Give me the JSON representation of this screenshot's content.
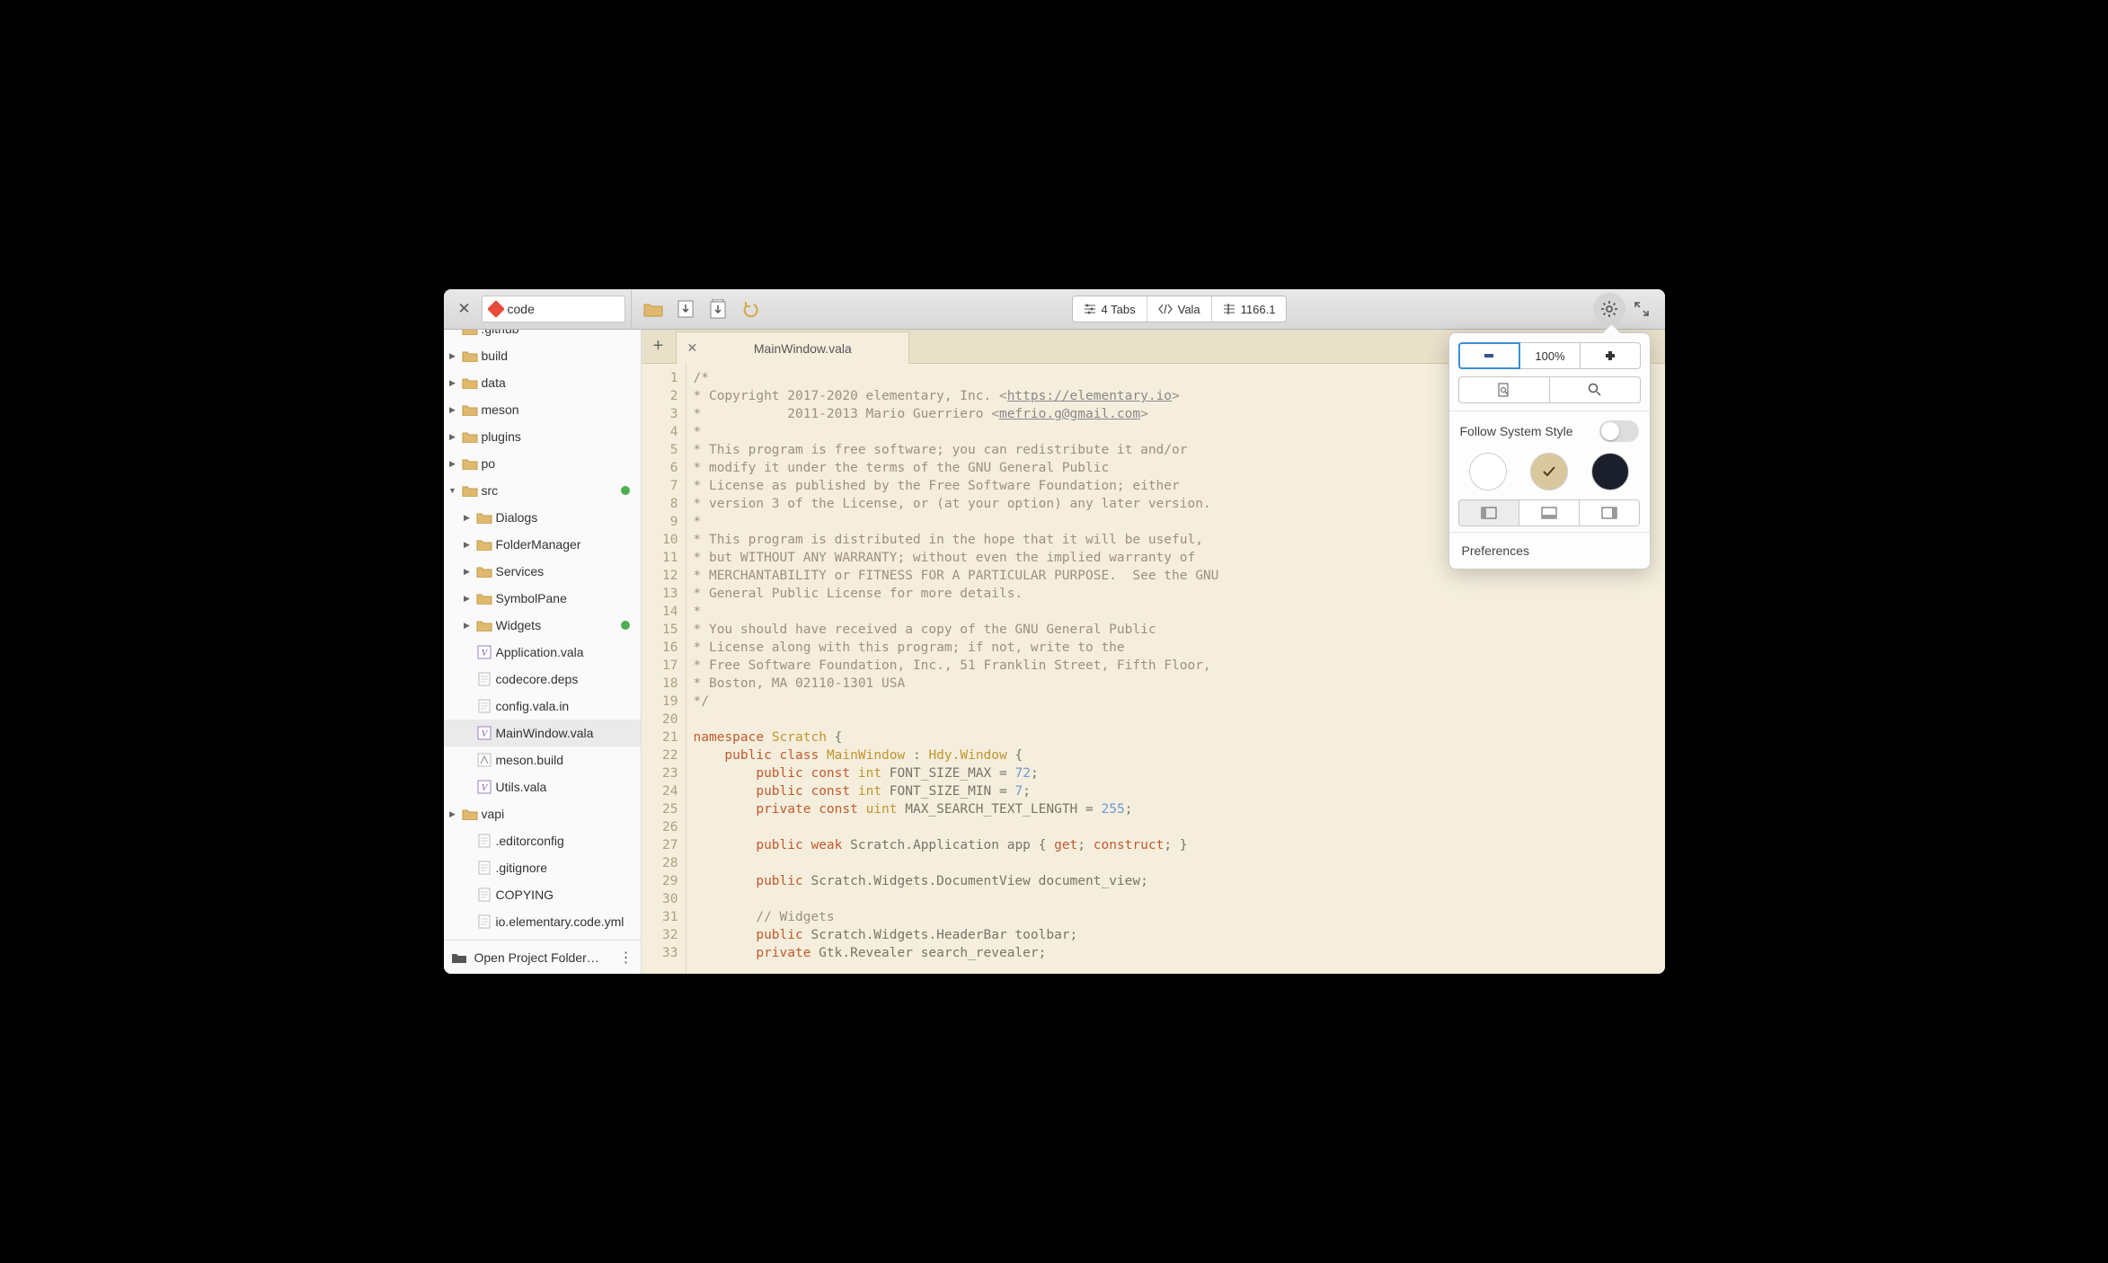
{
  "title_chip": "code",
  "toolbar": {
    "tabs_label": "4 Tabs",
    "lang_label": "Vala",
    "cursor_label": "1166.1"
  },
  "sidebar": {
    "items": [
      {
        "depth": 0,
        "icon": "folder",
        "label": ".github",
        "tri": "none",
        "partial": true
      },
      {
        "depth": 0,
        "icon": "folder",
        "label": "build",
        "tri": "right"
      },
      {
        "depth": 0,
        "icon": "folder",
        "label": "data",
        "tri": "right"
      },
      {
        "depth": 0,
        "icon": "folder",
        "label": "meson",
        "tri": "right"
      },
      {
        "depth": 0,
        "icon": "folder",
        "label": "plugins",
        "tri": "right"
      },
      {
        "depth": 0,
        "icon": "folder",
        "label": "po",
        "tri": "right"
      },
      {
        "depth": 0,
        "icon": "folder",
        "label": "src",
        "tri": "down",
        "dot": true
      },
      {
        "depth": 1,
        "icon": "folder",
        "label": "Dialogs",
        "tri": "right"
      },
      {
        "depth": 1,
        "icon": "folder",
        "label": "FolderManager",
        "tri": "right"
      },
      {
        "depth": 1,
        "icon": "folder",
        "label": "Services",
        "tri": "right"
      },
      {
        "depth": 1,
        "icon": "folder",
        "label": "SymbolPane",
        "tri": "right"
      },
      {
        "depth": 1,
        "icon": "folder",
        "label": "Widgets",
        "tri": "right",
        "dot": true
      },
      {
        "depth": 1,
        "icon": "vala",
        "label": "Application.vala",
        "tri": "none"
      },
      {
        "depth": 1,
        "icon": "file",
        "label": "codecore.deps",
        "tri": "none"
      },
      {
        "depth": 1,
        "icon": "file",
        "label": "config.vala.in",
        "tri": "none"
      },
      {
        "depth": 1,
        "icon": "vala",
        "label": "MainWindow.vala",
        "tri": "none",
        "selected": true
      },
      {
        "depth": 1,
        "icon": "build",
        "label": "meson.build",
        "tri": "none"
      },
      {
        "depth": 1,
        "icon": "vala",
        "label": "Utils.vala",
        "tri": "none"
      },
      {
        "depth": 0,
        "icon": "folder",
        "label": "vapi",
        "tri": "right"
      },
      {
        "depth": 0,
        "icon": "file",
        "label": ".editorconfig",
        "tri": "none",
        "indent_file": true
      },
      {
        "depth": 0,
        "icon": "file",
        "label": ".gitignore",
        "tri": "none",
        "indent_file": true
      },
      {
        "depth": 0,
        "icon": "file",
        "label": "COPYING",
        "tri": "none",
        "indent_file": true
      },
      {
        "depth": 0,
        "icon": "file",
        "label": "io.elementary.code.yml",
        "tri": "none",
        "indent_file": true
      }
    ],
    "footer_label": "Open Project Folder…"
  },
  "tab": {
    "title": "MainWindow.vala"
  },
  "code": {
    "lines": [
      {
        "n": 1,
        "html": "<span class='cmt'>/*</span>"
      },
      {
        "n": 2,
        "html": "<span class='cmt'>* Copyright 2017-2020 elementary, Inc. &lt;<span class='lnk'>https://elementary.io</span>&gt;</span>"
      },
      {
        "n": 3,
        "html": "<span class='cmt'>*           2011-2013 Mario Guerriero &lt;<span class='lnk'>mefrio.g@gmail.com</span>&gt;</span>"
      },
      {
        "n": 4,
        "html": "<span class='cmt'>*</span>"
      },
      {
        "n": 5,
        "html": "<span class='cmt'>* This program is free software; you can redistribute it and/or</span>"
      },
      {
        "n": 6,
        "html": "<span class='cmt'>* modify it under the terms of the GNU General Public</span>"
      },
      {
        "n": 7,
        "html": "<span class='cmt'>* License as published by the Free Software Foundation; either</span>"
      },
      {
        "n": 8,
        "html": "<span class='cmt'>* version 3 of the License, or (at your option) any later version.</span>"
      },
      {
        "n": 9,
        "html": "<span class='cmt'>*</span>"
      },
      {
        "n": 10,
        "html": "<span class='cmt'>* This program is distributed in the hope that it will be useful,</span>"
      },
      {
        "n": 11,
        "html": "<span class='cmt'>* but WITHOUT ANY WARRANTY; without even the implied warranty of</span>"
      },
      {
        "n": 12,
        "html": "<span class='cmt'>* MERCHANTABILITY or FITNESS FOR A PARTICULAR PURPOSE.  See the GNU</span>"
      },
      {
        "n": 13,
        "html": "<span class='cmt'>* General Public License for more details.</span>"
      },
      {
        "n": 14,
        "html": "<span class='cmt'>*</span>"
      },
      {
        "n": 15,
        "html": "<span class='cmt'>* You should have received a copy of the GNU General Public</span>"
      },
      {
        "n": 16,
        "html": "<span class='cmt'>* License along with this program; if not, write to the</span>"
      },
      {
        "n": 17,
        "html": "<span class='cmt'>* Free Software Foundation, Inc., 51 Franklin Street, Fifth Floor,</span>"
      },
      {
        "n": 18,
        "html": "<span class='cmt'>* Boston, MA 02110-1301 USA</span>"
      },
      {
        "n": 19,
        "html": "<span class='cmt'>*/</span>"
      },
      {
        "n": 20,
        "html": ""
      },
      {
        "n": 21,
        "html": "<span class='kw'>namespace</span> <span class='typ'>Scratch</span> {"
      },
      {
        "n": 22,
        "html": "    <span class='kw'>public</span> <span class='kw'>class</span> <span class='typ'>MainWindow</span> : <span class='typ'>Hdy.Window</span> {"
      },
      {
        "n": 23,
        "html": "        <span class='kw'>public</span> <span class='kw'>const</span> <span class='typ'>int</span> FONT_SIZE_MAX = <span class='num'>72</span>;"
      },
      {
        "n": 24,
        "html": "        <span class='kw'>public</span> <span class='kw'>const</span> <span class='typ'>int</span> FONT_SIZE_MIN = <span class='num'>7</span>;"
      },
      {
        "n": 25,
        "html": "        <span class='kw'>private</span> <span class='kw'>const</span> <span class='typ'>uint</span> MAX_SEARCH_TEXT_LENGTH = <span class='num'>255</span>;"
      },
      {
        "n": 26,
        "html": ""
      },
      {
        "n": 27,
        "html": "        <span class='kw'>public</span> <span class='kw'>weak</span> Scratch.Application app { <span class='kw'>get</span>; <span class='kw'>construct</span>; }"
      },
      {
        "n": 28,
        "html": ""
      },
      {
        "n": 29,
        "html": "        <span class='kw'>public</span> Scratch.Widgets.DocumentView document_view;"
      },
      {
        "n": 30,
        "html": ""
      },
      {
        "n": 31,
        "html": "        <span class='cmt'>// Widgets</span>"
      },
      {
        "n": 32,
        "html": "        <span class='kw'>public</span> Scratch.Widgets.HeaderBar toolbar;"
      },
      {
        "n": 33,
        "html": "        <span class='kw'>private</span> Gtk.Revealer search_revealer;"
      }
    ]
  },
  "popup": {
    "zoom_label": "100%",
    "follow_label": "Follow System Style",
    "preferences_label": "Preferences"
  }
}
